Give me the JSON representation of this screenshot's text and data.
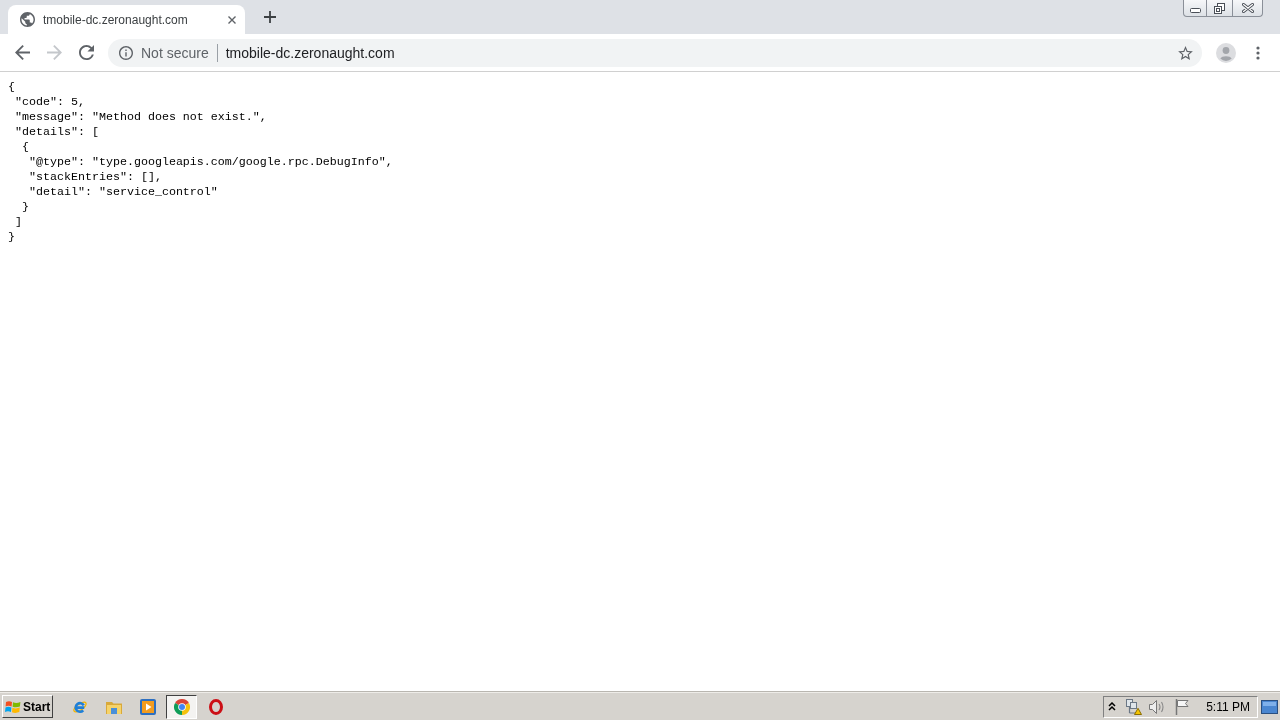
{
  "browser_tabs": [
    {
      "title": "tmobile-dc.zeronaught.com",
      "selected": true
    }
  ],
  "nav_buttons": [
    {
      "kind": "back",
      "disabled": false
    },
    {
      "kind": "forward",
      "disabled": true
    },
    {
      "kind": "reload",
      "disabled": false
    }
  ],
  "address_bar": {
    "security_label": "Not secure",
    "url": "tmobile-dc.zeronaught.com"
  },
  "page": {
    "body_text": "{\n \"code\": 5,\n \"message\": \"Method does not exist.\",\n \"details\": [\n  {\n   \"@type\": \"type.googleapis.com/google.rpc.DebugInfo\",\n   \"stackEntries\": [],\n   \"detail\": \"service_control\"\n  }\n ]\n}"
  },
  "taskbar": {
    "start_label": "Start",
    "apps": [
      {
        "kind": "ie",
        "selected": false
      },
      {
        "kind": "folder",
        "selected": false
      },
      {
        "kind": "media",
        "selected": false
      },
      {
        "kind": "chrome",
        "selected": true
      },
      {
        "kind": "opera",
        "selected": false
      }
    ],
    "clock": "5:11 PM"
  }
}
